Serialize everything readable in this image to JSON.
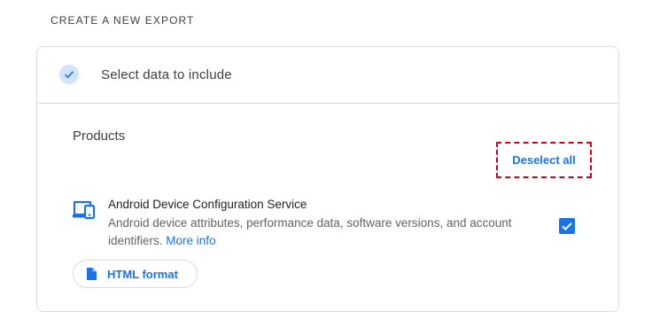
{
  "section": {
    "title": "CREATE A NEW EXPORT"
  },
  "step": {
    "label": "Select data to include",
    "icon": "check-icon",
    "completed": true
  },
  "products": {
    "label": "Products",
    "deselect_label": "Deselect all",
    "items": [
      {
        "name": "Android Device Configuration Service",
        "description": "Android device attributes, performance data, software versions, and account identifiers.",
        "more_info_label": "More info",
        "icon": "devices-icon",
        "checked": true,
        "format_label": "HTML format",
        "format_icon": "file-icon"
      }
    ]
  },
  "colors": {
    "accent": "#1a73e8",
    "highlight_border": "#d0021b",
    "step_icon_bg": "#d2e3fc",
    "divider": "#dadce0"
  }
}
